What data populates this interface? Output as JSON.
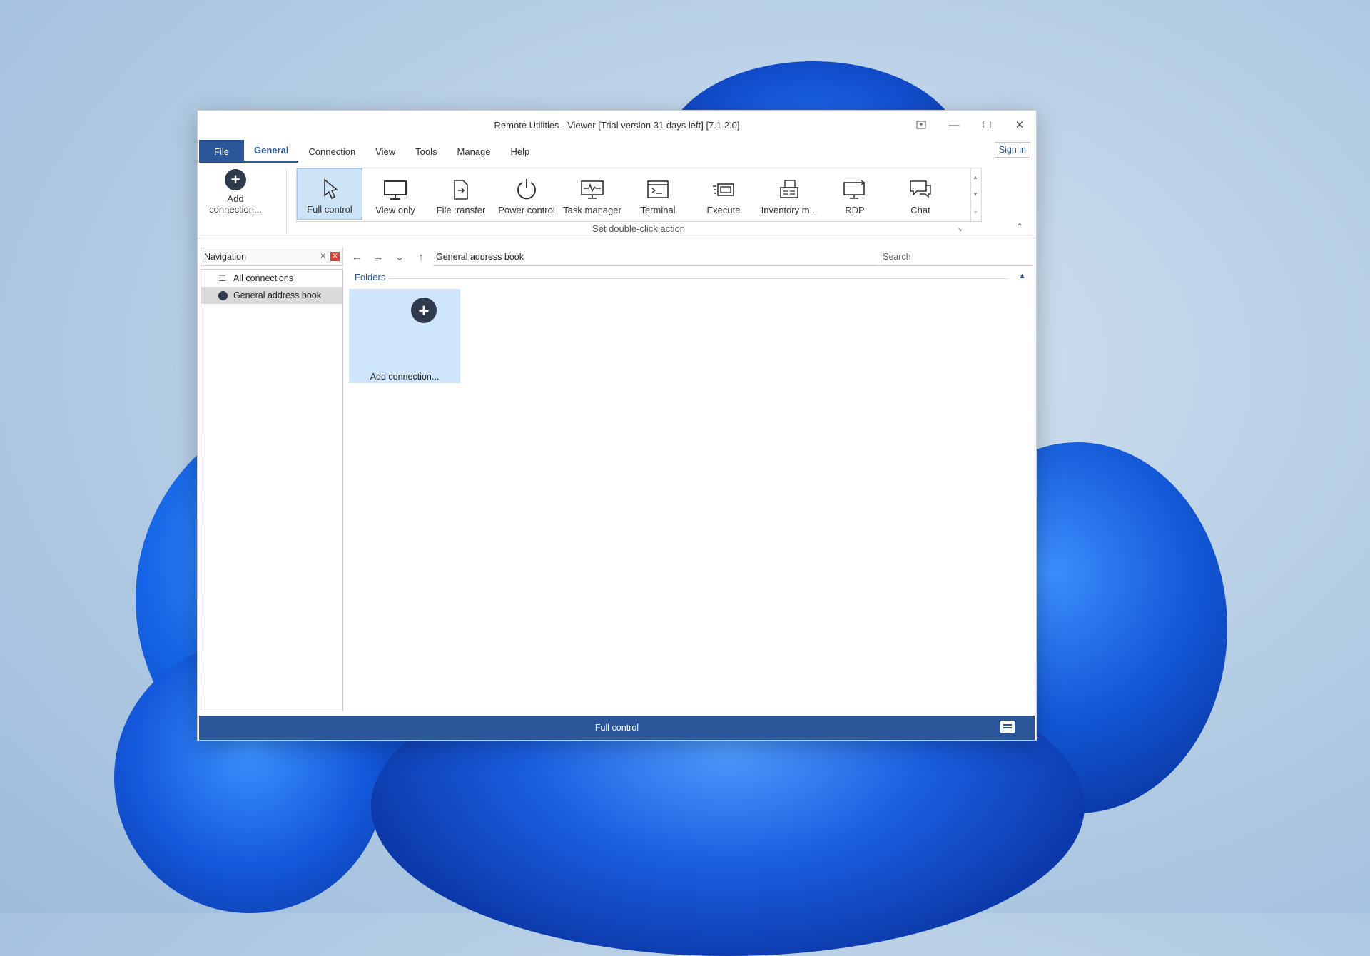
{
  "window": {
    "title": "Remote Utilities - Viewer [Trial version 31 days left] [7.1.2.0]"
  },
  "menu": {
    "file": "File",
    "items": [
      "General",
      "Connection",
      "View",
      "Tools",
      "Manage",
      "Help"
    ],
    "active": "General",
    "sign_in": "Sign in"
  },
  "ribbon": {
    "add_connection": "Add connection...",
    "tools": [
      {
        "label": "Full control",
        "icon": "cursor-icon",
        "selected": true
      },
      {
        "label": "View only",
        "icon": "monitor-icon"
      },
      {
        "label": "File :ransfer",
        "icon": "file-transfer-icon"
      },
      {
        "label": "Power control",
        "icon": "power-icon"
      },
      {
        "label": "Task manager",
        "icon": "task-manager-icon"
      },
      {
        "label": "Terminal",
        "icon": "terminal-icon"
      },
      {
        "label": "Execute",
        "icon": "execute-icon"
      },
      {
        "label": "Inventory m...",
        "icon": "inventory-icon"
      },
      {
        "label": "RDP",
        "icon": "rdp-icon"
      },
      {
        "label": "Chat",
        "icon": "chat-icon"
      }
    ],
    "caption": "Set double-click action"
  },
  "navigation": {
    "title": "Navigation",
    "items": [
      {
        "label": "All connections",
        "icon": "list-icon"
      },
      {
        "label": "General address book",
        "icon": "address-book-icon",
        "selected": true
      }
    ]
  },
  "content": {
    "address": "General address book",
    "search_placeholder": "Search",
    "folders_label": "Folders",
    "tile_label": "Add connection..."
  },
  "status": {
    "text": "Full control"
  },
  "colors": {
    "accent": "#2b579a",
    "selection": "#cde3f6"
  }
}
